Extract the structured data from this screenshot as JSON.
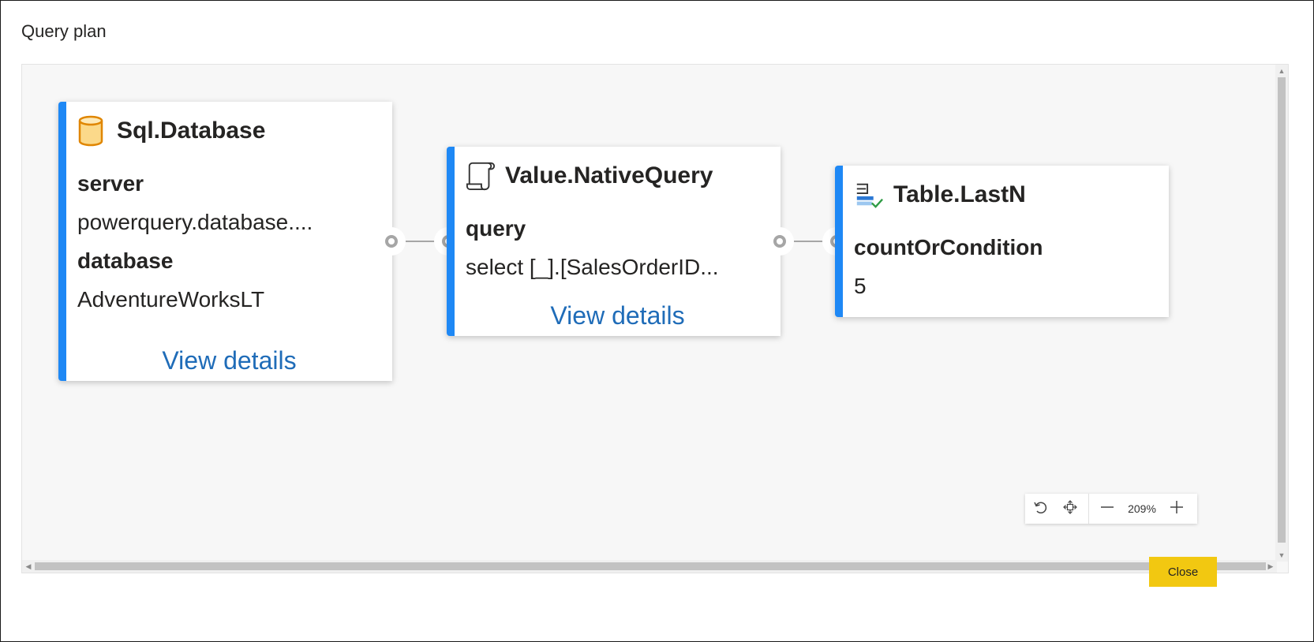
{
  "dialog": {
    "title": "Query plan",
    "close_label": "Close"
  },
  "nodes": [
    {
      "title": "Sql.Database",
      "icon": "database-cylinder-icon",
      "props": [
        {
          "label": "server",
          "value": "powerquery.database...."
        },
        {
          "label": "database",
          "value": "AdventureWorksLT"
        }
      ],
      "link": "View details"
    },
    {
      "title": "Value.NativeQuery",
      "icon": "script-scroll-icon",
      "props": [
        {
          "label": "query",
          "value": "select [_].[SalesOrderID..."
        }
      ],
      "link": "View details"
    },
    {
      "title": "Table.LastN",
      "icon": "table-lastn-icon",
      "props": [
        {
          "label": "countOrCondition",
          "value": "5"
        }
      ]
    }
  ],
  "zoom": {
    "value": "209%"
  },
  "colors": {
    "accent": "#1e88f5",
    "link": "#1f6cb8",
    "close_button": "#f2c811",
    "connector": "#a6a6a6"
  }
}
